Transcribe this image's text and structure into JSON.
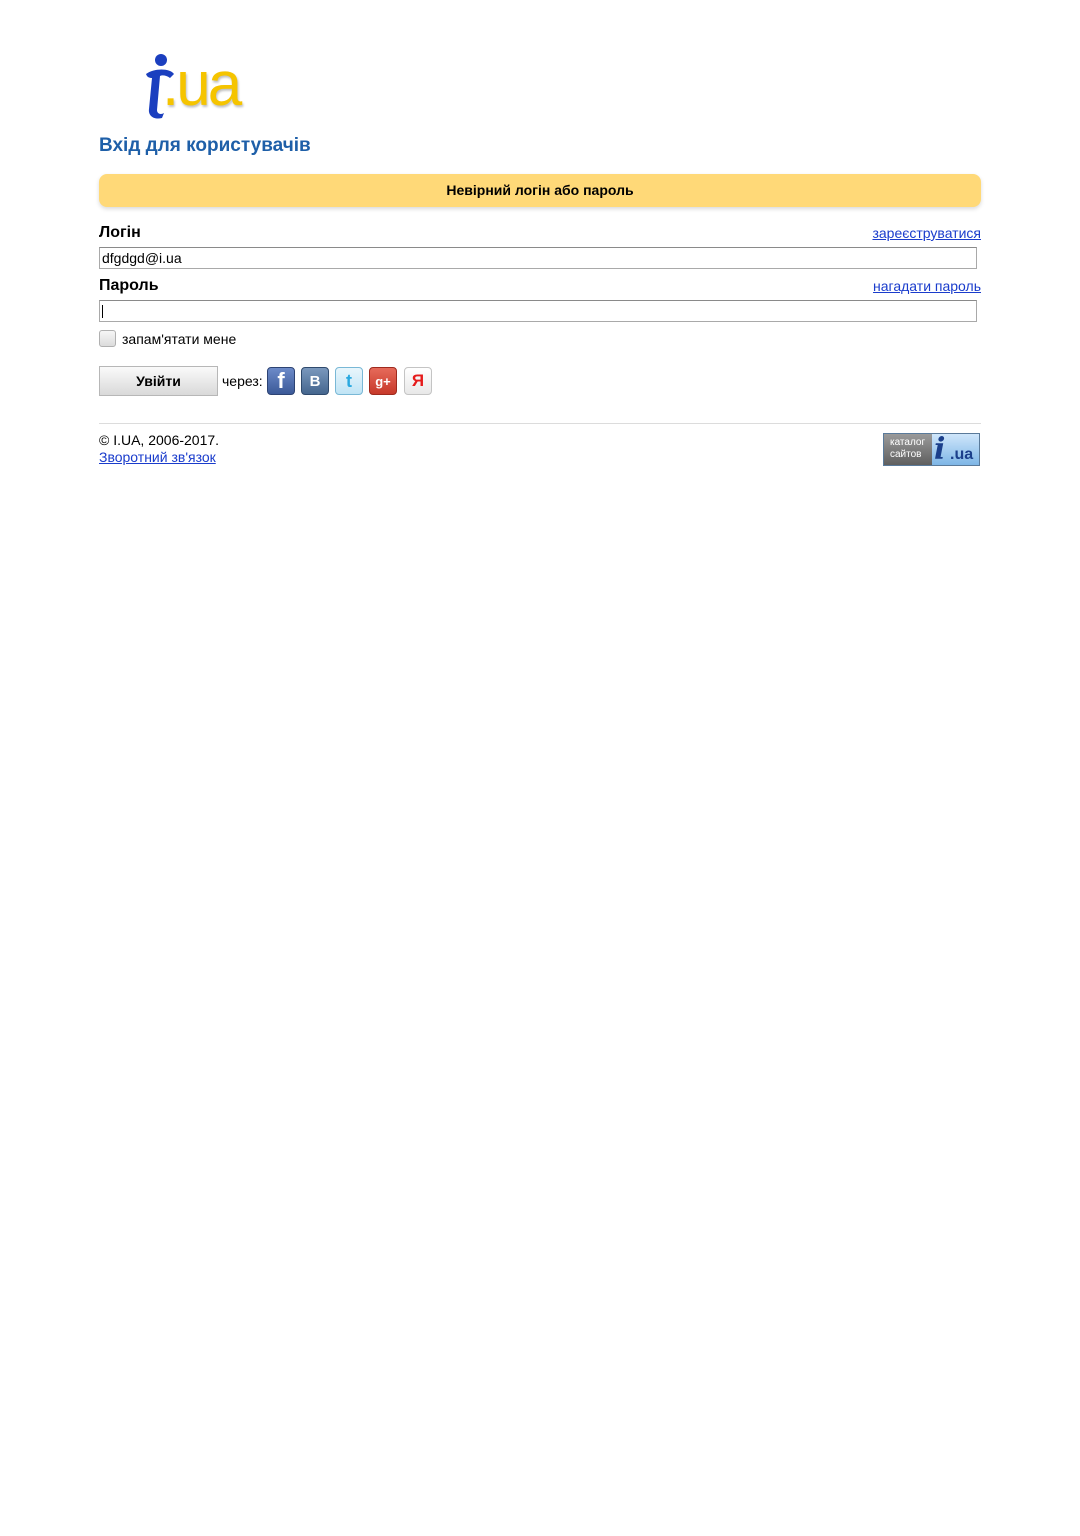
{
  "logo": {
    "text": ".ua",
    "icon": "i-ua-logo-icon"
  },
  "page_title": "Вхід для користувачів",
  "error_message": "Невірний логін або пароль",
  "login": {
    "label": "Логін",
    "register_link": "зареєструватися",
    "value": "dfgdgd@i.ua"
  },
  "password": {
    "label": "Пароль",
    "remind_link": "нагадати пароль",
    "value": ""
  },
  "remember": {
    "label": "запам'ятати мене",
    "checked": false
  },
  "submit_label": "Увійти",
  "via_label": "через:",
  "social": [
    {
      "name": "facebook",
      "glyph": "f"
    },
    {
      "name": "vkontakte",
      "glyph": "B"
    },
    {
      "name": "twitter",
      "glyph": "t"
    },
    {
      "name": "google-plus",
      "glyph": "g+"
    },
    {
      "name": "yandex",
      "glyph": "Я"
    }
  ],
  "footer": {
    "copyright": "© I.UA, 2006-2017.",
    "feedback_link": "Зворотний зв'язок",
    "catalog_badge": {
      "line1": "каталог",
      "line2": "сайтов",
      "i": "i",
      "ua": ".ua"
    }
  },
  "colors": {
    "title": "#1e5fa8",
    "error_bg": "#ffd978",
    "link": "#1a3ccc",
    "logo_yellow": "#f5c400",
    "logo_blue": "#1b3fbf"
  }
}
